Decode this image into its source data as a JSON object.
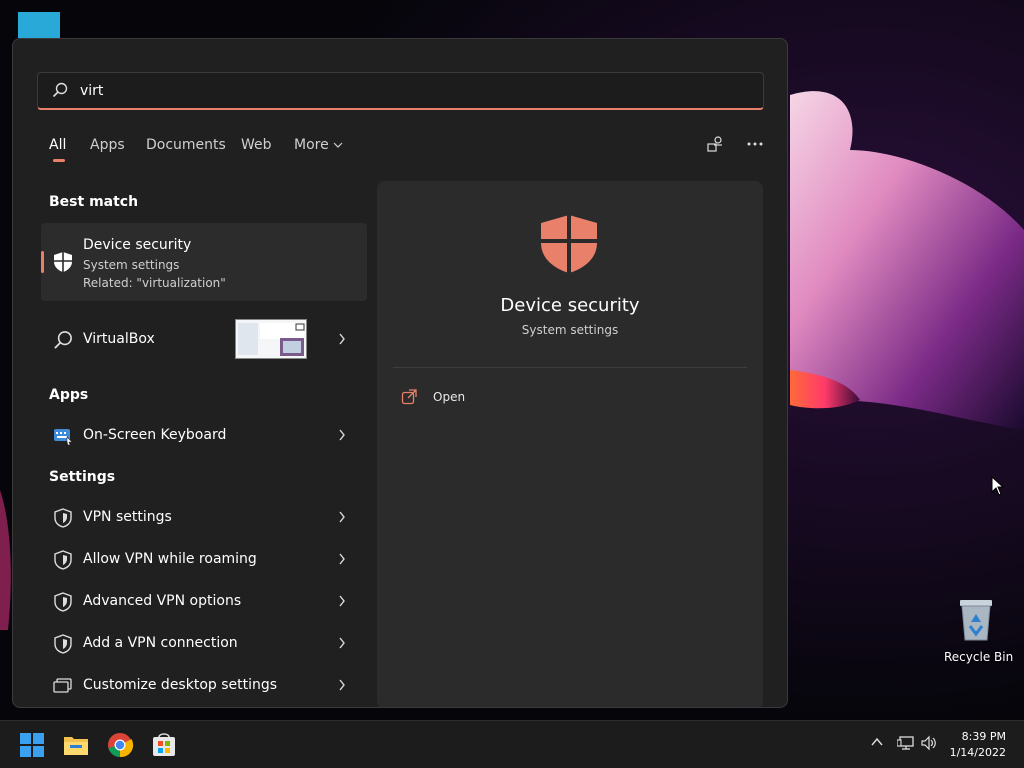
{
  "search": {
    "value": "virt"
  },
  "tabs": [
    {
      "label": "All",
      "active": true
    },
    {
      "label": "Apps"
    },
    {
      "label": "Documents"
    },
    {
      "label": "Web"
    },
    {
      "label": "More"
    }
  ],
  "sections": {
    "best_match": "Best match",
    "apps": "Apps",
    "settings": "Settings"
  },
  "best_match": {
    "title": "Device security",
    "subtitle": "System settings",
    "related": "Related: \"virtualization\"",
    "icon": "shield-icon"
  },
  "web_result": {
    "label": "VirtualBox",
    "icon": "search-icon"
  },
  "apps": [
    {
      "label": "On-Screen Keyboard",
      "icon": "keyboard-app-icon"
    }
  ],
  "settings": [
    {
      "label": "VPN settings",
      "icon": "shield-outline-icon"
    },
    {
      "label": "Allow VPN while roaming",
      "icon": "shield-outline-icon"
    },
    {
      "label": "Advanced VPN options",
      "icon": "shield-outline-icon"
    },
    {
      "label": "Add a VPN connection",
      "icon": "shield-outline-icon"
    },
    {
      "label": "Customize desktop settings",
      "icon": "monitor-icon"
    }
  ],
  "preview": {
    "title": "Device security",
    "subtitle": "System settings",
    "actions": [
      {
        "label": "Open",
        "icon": "open-external-icon"
      }
    ]
  },
  "desktop": {
    "recycle_bin": "Recycle Bin"
  },
  "taskbar": {
    "time": "8:39 PM",
    "date": "1/14/2022",
    "apps": [
      "start-icon",
      "file-explorer-icon",
      "chrome-icon",
      "store-icon"
    ]
  },
  "colors": {
    "accent": "#e8806a",
    "panel": "#202020",
    "preview": "#2b2b2b"
  }
}
